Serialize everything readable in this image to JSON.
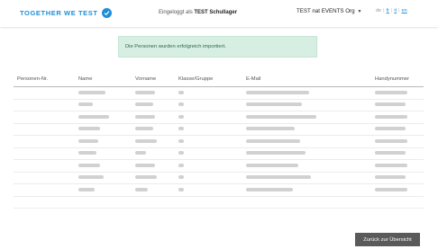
{
  "header": {
    "brand": "TOGETHER WE TEST",
    "logged_in_prefix": "Eingeloggt als",
    "logged_in_user": "TEST Schullager",
    "org_selector": "TEST nat EVENTS Org",
    "languages": [
      "de",
      "fr",
      "it",
      "en"
    ],
    "active_language": "de"
  },
  "alert": {
    "message": "Die Personen wurden erfolgreich importiert."
  },
  "table": {
    "columns": [
      "Personen-Nr.",
      "Name",
      "Vorname",
      "Klasse/Gruppe",
      "E-Mail",
      "Handynummer"
    ],
    "rows": [
      {
        "id": "",
        "name": "",
        "firstname": "",
        "class": "",
        "email": "",
        "phone": ""
      },
      {
        "id": "",
        "name": "",
        "firstname": "",
        "class": "",
        "email": "",
        "phone": ""
      },
      {
        "id": "",
        "name": "",
        "firstname": "",
        "class": "",
        "email": "",
        "phone": ""
      },
      {
        "id": "",
        "name": "",
        "firstname": "",
        "class": "",
        "email": "",
        "phone": ""
      },
      {
        "id": "",
        "name": "",
        "firstname": "",
        "class": "",
        "email": "",
        "phone": ""
      },
      {
        "id": "",
        "name": "",
        "firstname": "",
        "class": "",
        "email": "",
        "phone": ""
      },
      {
        "id": "",
        "name": "",
        "firstname": "",
        "class": "",
        "email": "",
        "phone": ""
      },
      {
        "id": "",
        "name": "",
        "firstname": "",
        "class": "",
        "email": "",
        "phone": ""
      },
      {
        "id": "",
        "name": "",
        "firstname": "",
        "class": "",
        "email": "",
        "phone": ""
      },
      {
        "id": "",
        "name": "",
        "firstname": "",
        "class": "",
        "email": "",
        "phone": ""
      }
    ]
  },
  "footer": {
    "back_label": "Zurück zur Übersicht"
  },
  "colors": {
    "brand": "#1e8fd6",
    "alert_bg": "#d6efe2",
    "alert_text": "#2f6b4c",
    "button_bg": "#5a5a5a"
  }
}
